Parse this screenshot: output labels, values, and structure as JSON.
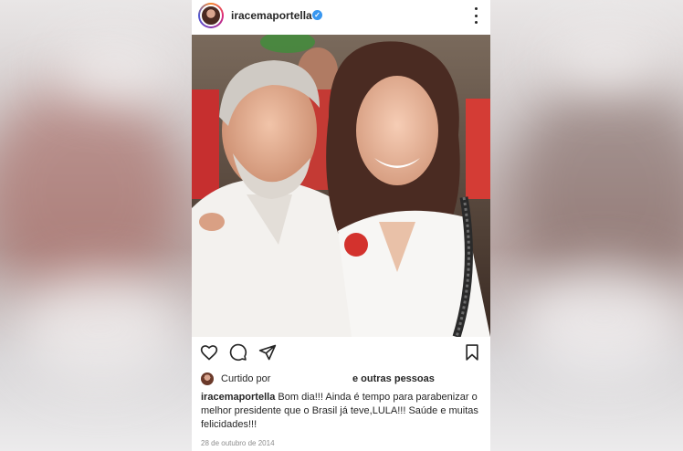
{
  "post": {
    "username": "iracemaportella",
    "verified_badge": "✓",
    "liked_by_prefix": "Curtido por",
    "liked_by_others": "e outras pessoas",
    "caption_username": "iracemaportella",
    "caption_text": "Bom dia!!! Ainda é tempo para parabenizar o melhor presidente que o Brasil já teve,LULA!!! Saúde e muitas felicidades!!!",
    "date": "28 de outubro de 2014"
  },
  "icons": {
    "more": "more-options-icon",
    "like": "heart-icon",
    "comment": "comment-icon",
    "share": "share-icon",
    "save": "bookmark-icon"
  },
  "colors": {
    "text": "#262626",
    "muted": "#8e8e8e",
    "verified": "#3897f0",
    "background": "#ffffff"
  }
}
